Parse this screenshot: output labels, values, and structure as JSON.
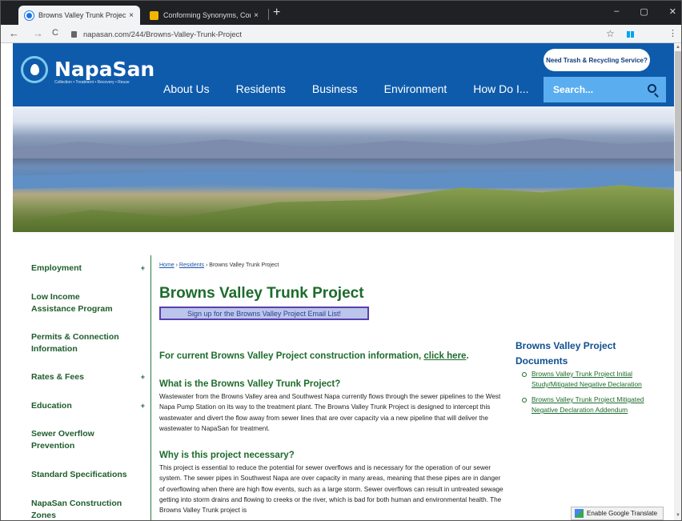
{
  "browser": {
    "tabs": [
      {
        "title": "Browns Valley Trunk Project | Na",
        "close": "×"
      },
      {
        "title": "Conforming Synonyms, Conform",
        "close": "×"
      }
    ],
    "new_tab": "+",
    "window_controls": [
      "–",
      "▢",
      "✕"
    ],
    "back": "←",
    "forward": "→",
    "reload": "C",
    "url": "napasan.com/244/Browns-Valley-Trunk-Project",
    "star": "☆",
    "menu": "⋮"
  },
  "site": {
    "logo_name": "NapaSan",
    "logo_tagline": "Collection • Treatment • Recovery • Reuse",
    "need_service": "Need Trash & Recycling Service?",
    "nav": [
      "About Us",
      "Residents",
      "Business",
      "Environment",
      "How Do I..."
    ],
    "search_placeholder": "Search...",
    "colors": {
      "header_blue": "#0e5bab",
      "search_blue": "#5aaef0",
      "heading_green": "#1d6b2c"
    }
  },
  "sidebar": {
    "items": [
      {
        "label": "Employment",
        "expand": "+"
      },
      {
        "label": "Low Income Assistance Program",
        "expand": ""
      },
      {
        "label": "Permits & Connection Information",
        "expand": ""
      },
      {
        "label": "Rates & Fees",
        "expand": "+"
      },
      {
        "label": "Education",
        "expand": "+"
      },
      {
        "label": "Sewer Overflow Prevention",
        "expand": ""
      },
      {
        "label": "Standard Specifications",
        "expand": ""
      },
      {
        "label": "NapaSan Construction Zones",
        "expand": ""
      }
    ]
  },
  "main": {
    "breadcrumb": {
      "home": "Home",
      "sep1": " › ",
      "residents": "Residents",
      "sep2": " › ",
      "current": "Browns Valley Trunk Project"
    },
    "title": "Browns Valley Trunk Project",
    "signup": "Sign up for the Browns Valley Project Email List!",
    "current_info_prefix": "For current Browns Valley Project construction information, ",
    "current_info_link": "click here",
    "current_info_suffix": ".",
    "q1": "What is the Browns Valley Trunk Project?",
    "p1": "Wastewater from the Browns Valley area and Southwest Napa currently flows through the sewer pipelines to the West Napa Pump Station on its way to the treatment plant.  The Browns Valley Trunk Project is designed to intercept this wastewater and divert the flow away from sewer lines that are over capacity via a new pipeline that will deliver the wastewater to NapaSan for treatment.",
    "q2": "Why is this project necessary?",
    "p2": "This project is essential to reduce the potential for sewer overflows and is necessary for the operation of our sewer system. The sewer pipes in Southwest Napa are over capacity in many areas, meaning that these pipes are in danger of overflowing when there are high flow events, such as a large storm.  Sewer overflows can result in untreated sewage getting into storm drains and flowing to creeks or the river, which is bad for both human and environmental health.  The Browns Valley Trunk project is"
  },
  "documents": {
    "title": "Browns Valley Project Documents",
    "items": [
      "Browns Valley Trunk Project Initial Study/Mitigated Negative Declaration",
      "Browns Valley Trunk Project Mitigated Negative Declaration Addendum"
    ]
  },
  "translate": "Enable Google Translate"
}
